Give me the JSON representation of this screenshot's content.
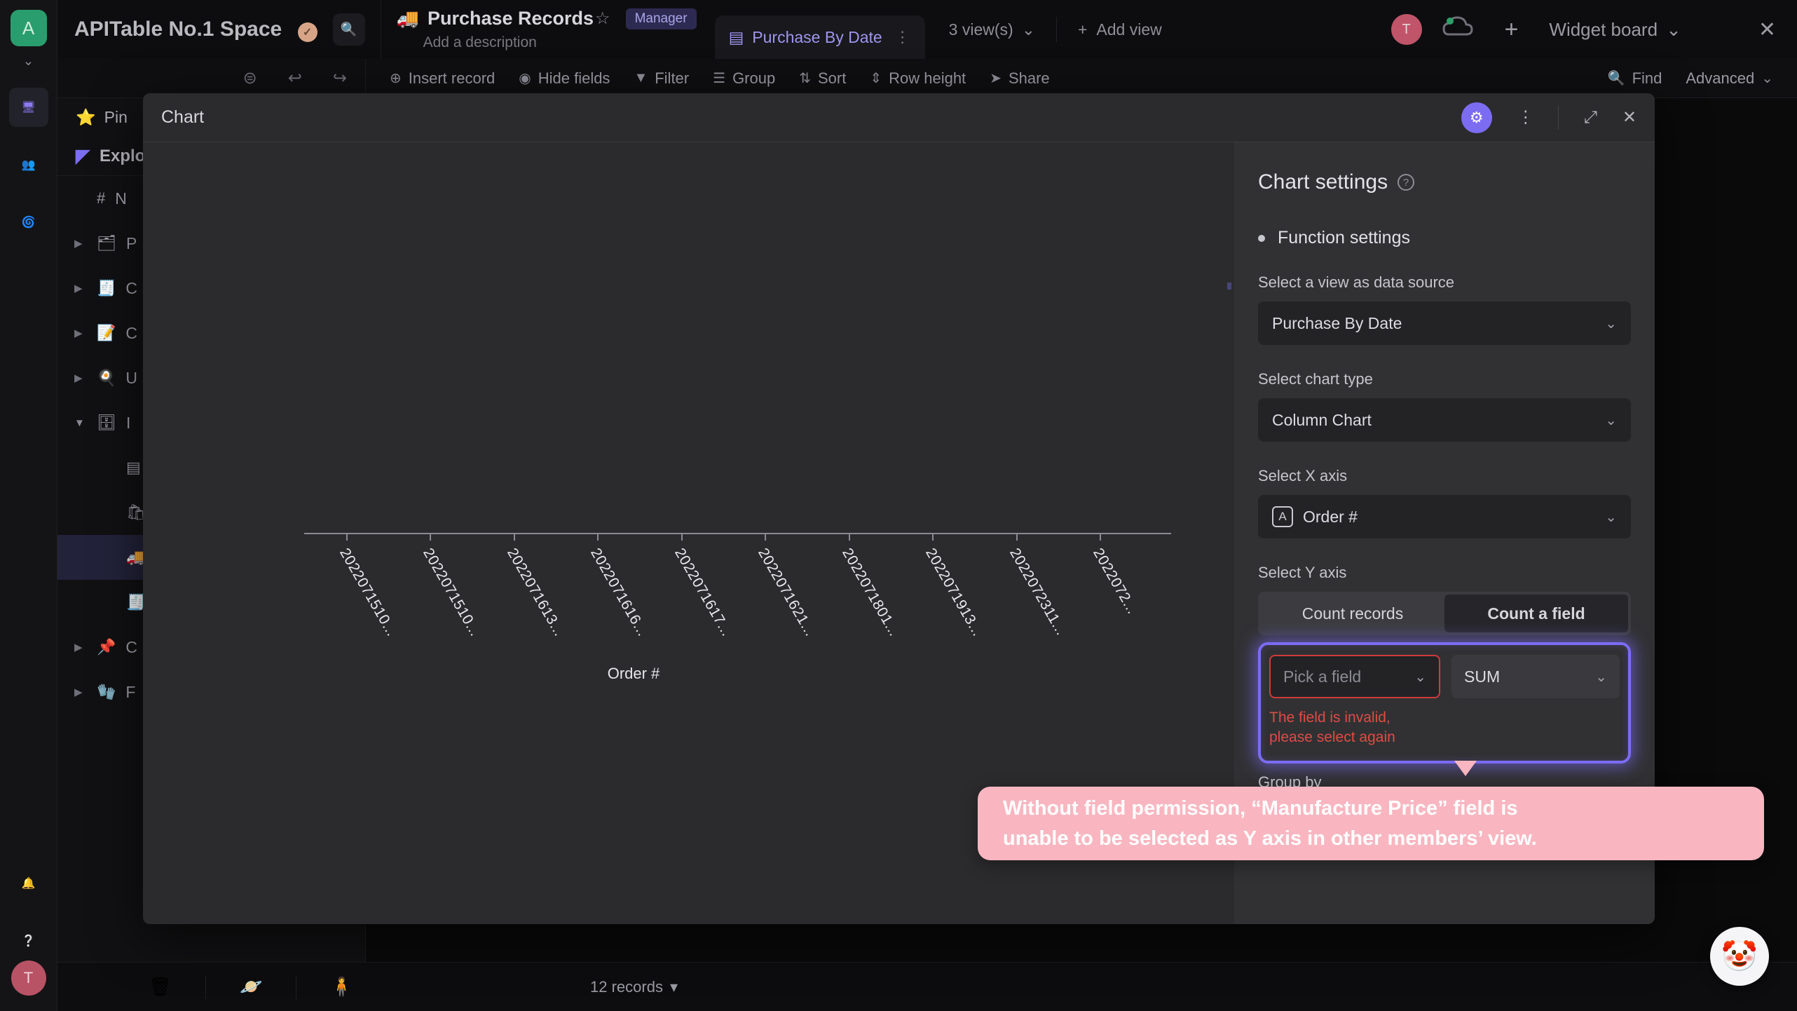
{
  "left_rail": {
    "space_initial": "A",
    "caret": "⌄",
    "icons": [
      {
        "name": "workbench-icon",
        "glyph": "🖥"
      },
      {
        "name": "members-icon",
        "glyph": "👥"
      },
      {
        "name": "template-icon",
        "glyph": "🌀"
      },
      {
        "name": "notification-icon",
        "glyph": "🔔"
      },
      {
        "name": "help-icon",
        "glyph": "❔"
      }
    ],
    "user_initial": "T"
  },
  "topbar": {
    "space_name": "APITable No.1 Space",
    "space_badge": "✓",
    "search_icon": "🔍",
    "datasheet_emoji": "🚚",
    "datasheet_title": "Purchase Records",
    "star": "☆",
    "role_badge": "Manager",
    "description_placeholder": "Add a description",
    "active_view": "Purchase By Date",
    "view_icon": "▤",
    "view_more": "⋮",
    "views_count": "3 view(s)",
    "views_caret": "⌄",
    "add_view": "Add view",
    "add_view_plus": "+",
    "collaborator_initial": "T",
    "cloud_icon": "☁",
    "plus_icon": "+",
    "widget_board": "Widget board",
    "widget_caret": "⌄",
    "close_icon": "✕"
  },
  "toolbar": {
    "items": [
      {
        "icon": "⊕",
        "label": "Insert record"
      },
      {
        "icon": "◉",
        "label": "Hide fields"
      },
      {
        "icon": "▼",
        "label": "Filter"
      },
      {
        "icon": "☰",
        "label": "Group"
      },
      {
        "icon": "⇅",
        "label": "Sort"
      },
      {
        "icon": "⇕",
        "label": "Row height"
      },
      {
        "icon": "➤",
        "label": "Share"
      }
    ],
    "right_items": [
      {
        "icon": "🔍",
        "label": "Find"
      },
      {
        "icon": "",
        "label": "Advanced"
      }
    ],
    "advanced_caret": "⌄",
    "undo_icon": "↩",
    "redo_icon": "↪",
    "collapse_icon": "⊜"
  },
  "sidebar": {
    "pin_label": "Pin",
    "pin_star": "⭐",
    "pin_caret": "⌃",
    "explore_label": "Explore",
    "tree": [
      {
        "arrow": "",
        "emoji": "#",
        "label": "N",
        "indent": 0,
        "selected": false
      },
      {
        "arrow": "▶",
        "emoji": "🗂",
        "label": "P",
        "indent": 0,
        "selected": false
      },
      {
        "arrow": "▶",
        "emoji": "🧾",
        "label": "C",
        "indent": 0,
        "selected": false
      },
      {
        "arrow": "▶",
        "emoji": "📝",
        "label": "C",
        "indent": 0,
        "selected": false
      },
      {
        "arrow": "▶",
        "emoji": "🍳",
        "label": "U",
        "indent": 0,
        "selected": false
      },
      {
        "arrow": "▼",
        "emoji": "🗄",
        "label": "I",
        "indent": 0,
        "selected": false
      },
      {
        "arrow": "",
        "emoji": "▤",
        "label": "",
        "indent": 1,
        "selected": false
      },
      {
        "arrow": "",
        "emoji": "🛍",
        "label": "",
        "indent": 1,
        "selected": false
      },
      {
        "arrow": "",
        "emoji": "🚚",
        "label": "",
        "indent": 1,
        "selected": true
      },
      {
        "arrow": "",
        "emoji": "🧾",
        "label": "",
        "indent": 1,
        "selected": false
      },
      {
        "arrow": "▶",
        "emoji": "📌",
        "label": "C",
        "indent": 0,
        "selected": false
      },
      {
        "arrow": "▶",
        "emoji": "🧤",
        "label": "F",
        "indent": 0,
        "selected": false
      }
    ]
  },
  "bottombar": {
    "icons": [
      {
        "name": "trash-icon",
        "glyph": "🗑"
      },
      {
        "name": "robot-icon",
        "glyph": "🪐"
      },
      {
        "name": "add-member-icon",
        "glyph": "🧍"
      }
    ],
    "records_text": "12 records",
    "records_caret": "▾"
  },
  "modal": {
    "title": "Chart",
    "gear_icon": "⚙",
    "more_icon": "⋮",
    "expand_icon": "⤢",
    "close_icon": "✕"
  },
  "settings": {
    "panel_title": "Chart settings",
    "help_glyph": "?",
    "section_title": "Function settings",
    "data_source_label": "Select a view as data source",
    "data_source_value": "Purchase By Date",
    "chart_type_label": "Select chart type",
    "chart_type_value": "Column Chart",
    "x_axis_label": "Select X axis",
    "x_axis_value": "Order #",
    "x_axis_field_type": "A",
    "y_axis_label": "Select Y axis",
    "y_tab_count_records": "Count records",
    "y_tab_count_field": "Count a field",
    "pick_field_placeholder": "Pick a field",
    "aggregate_value": "SUM",
    "error_line1": "The field is invalid,",
    "error_line2": "please select again",
    "group_by_label": "Group by",
    "chevron": "⌄",
    "highlight_color": "#7b6cf5",
    "error_color": "#e04b43"
  },
  "callout": {
    "line1": "Without field permission, “Manufacture Price” field is",
    "line2": "unable to be selected as Y axis in other members’ view.",
    "background": "#f9b6c0",
    "text_color": "#ffffff"
  },
  "help_bubble": {
    "glyph": "🤡"
  },
  "chart_data": {
    "type": "bar",
    "title": "",
    "xlabel": "Order #",
    "ylabel": "",
    "grid": false,
    "legend": "none",
    "categories": [
      "2022071510...",
      "2022071510...",
      "2022071613...",
      "2022071616...",
      "2022071617...",
      "2022071621...",
      "2022071801...",
      "2022071913...",
      "2022072311...",
      "2022072..."
    ],
    "values": [
      0,
      0,
      0,
      0,
      0,
      0,
      0,
      0,
      0,
      0
    ],
    "note": "No series rendered - Y axis field is invalid"
  }
}
